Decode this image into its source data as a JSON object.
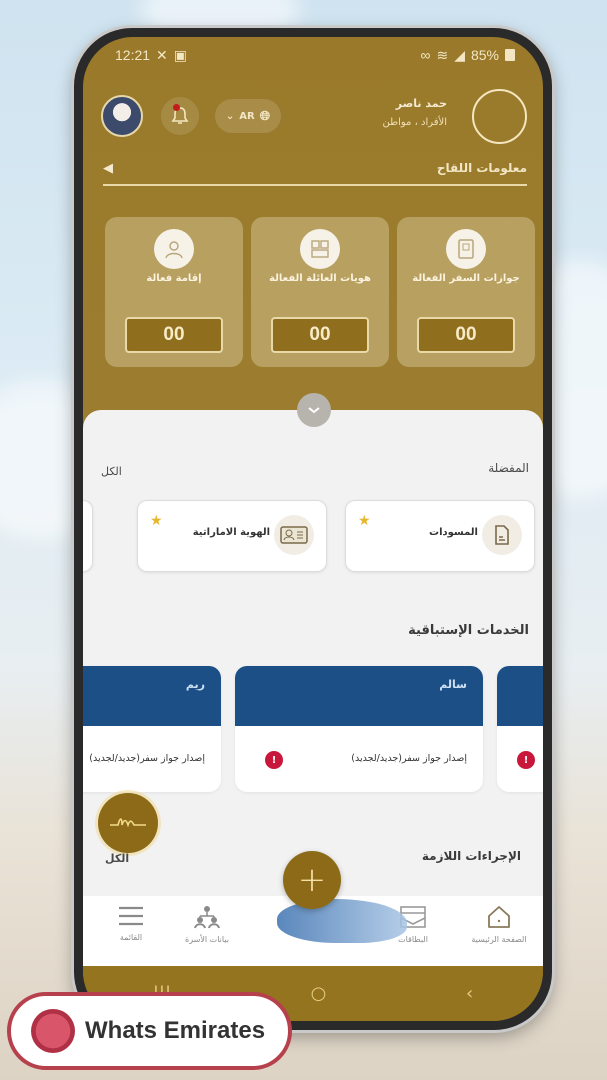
{
  "status_bar": {
    "time": "12:21",
    "battery": "85%"
  },
  "header": {
    "user_name": "حمد ناصر",
    "user_role": "الأفراد ، مواطن",
    "language": "AR"
  },
  "vaccination": {
    "title": "معلومات اللقاح"
  },
  "stats": [
    {
      "label": "جوازات السفر الفعالة",
      "count": "00",
      "icon": "passport-icon"
    },
    {
      "label": "هويات العائلة الفعالة",
      "count": "00",
      "icon": "family-ids-icon"
    },
    {
      "label": "إقامة فعالة",
      "count": "00",
      "icon": "residency-icon"
    }
  ],
  "favorites": {
    "title": "المفضلة",
    "all_label": "الكل",
    "items": [
      {
        "label": "المسودات",
        "icon": "document-icon",
        "starred": true
      },
      {
        "label": "الهوية الاماراتية",
        "icon": "id-card-icon",
        "starred": true
      }
    ]
  },
  "proactive": {
    "title": "الخدمات الإستباقية",
    "cards": [
      {
        "name": "سالم",
        "service": "إصدار جواز سفر(جديد/لجديد)",
        "alert": "!"
      },
      {
        "name": "ريم",
        "service": "إصدار جواز سفر(جديد/لجديد)",
        "alert": "!"
      }
    ]
  },
  "required_actions": {
    "title": "الإجراءات اللازمة",
    "all_label": "الكل"
  },
  "bottom_nav": {
    "items": [
      {
        "label": "الصفحة الرئيسية",
        "icon": "home-icon"
      },
      {
        "label": "البطاقات",
        "icon": "cards-icon"
      },
      {
        "label": "بيانات الأسرة",
        "icon": "family-tree-icon"
      },
      {
        "label": "القائمة",
        "icon": "menu-icon"
      }
    ],
    "center_fab": "+"
  },
  "system_nav": {
    "recents": "|||",
    "home": "○",
    "back": "‹"
  },
  "watermark": {
    "text": "Whats Emirates"
  },
  "colors": {
    "gold": "#9a7a2a",
    "blue": "#1b4f86",
    "alert_red": "#c8173a",
    "star": "#e4b72c"
  }
}
